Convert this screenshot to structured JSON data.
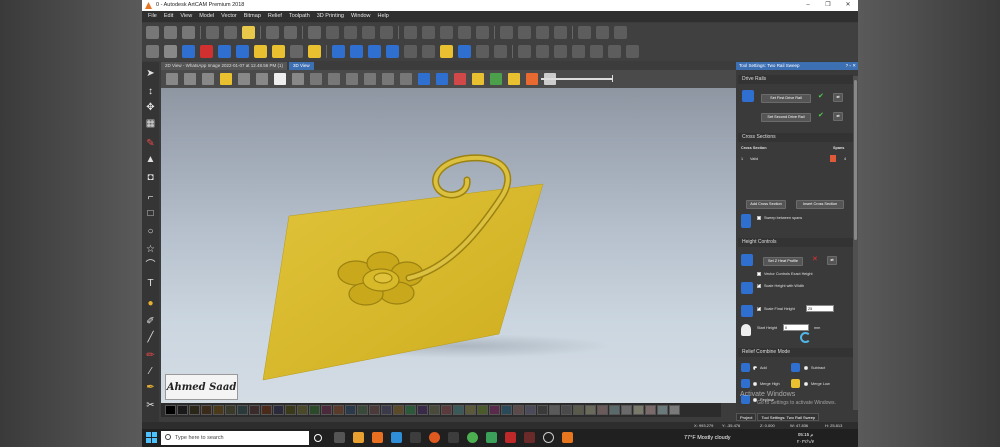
{
  "titlebar": {
    "title": "0 - Autodesk ArtCAM Premium 2018",
    "controls": [
      "–",
      "❐",
      "✕"
    ]
  },
  "menu": [
    "File",
    "Edit",
    "View",
    "Model",
    "Vector",
    "Bitmap",
    "Relief",
    "Toolpath",
    "3D Printing",
    "Window",
    "Help"
  ],
  "tabs": [
    {
      "label": "2D View - WhatsApp Image 2022-01-07 at 12.48.56 PM (1)"
    },
    {
      "label": "3D View"
    }
  ],
  "signature": "Ahmed Saad",
  "panel": {
    "title": "Tool Settings: Two Rail Sweep",
    "title_controls": "? ▫ ✕",
    "drive_rails": {
      "heading": "Drive Rails",
      "first_button": "Set First Drive Rail",
      "second_button": "Set Second Drive Rail"
    },
    "cross_sections": {
      "heading": "Cross Sections",
      "col_cross_section": "Cross Section",
      "col_spans": "Spans",
      "row_index": "1",
      "row_status": "Valid",
      "row_spans": "4",
      "add_button": "Add Cross Section",
      "insert_button": "Insert Cross Section",
      "sweep_between_spans": "Sweep between spans"
    },
    "height_controls": {
      "heading": "Height Controls",
      "set_profile_button": "Set Z Heat Profile",
      "vector_controls": "Vector Controls Exact Height",
      "scale_height": "Scale Height with Width",
      "scale_final_height": "Scale Final Height",
      "final_height_value": "25",
      "start_height_label": "Start Height",
      "start_height_value": "0",
      "unit": "mm"
    },
    "relief_combine": {
      "heading": "Relief Combine Mode",
      "add": "Add",
      "subtract": "Subtract",
      "merge_high": "Merge High",
      "merge_low": "Merge Low",
      "replace": "Replace"
    }
  },
  "panel_tabs": [
    "Project",
    "Tool Settings: Two Rail Sweep"
  ],
  "watermark": {
    "line1": "Activate Windows",
    "line2": "Go to Settings to activate Windows."
  },
  "status": {
    "x": "X: 993.279",
    "y": "Y: -35.476",
    "z": "Z: 0.000",
    "w": "W: 47.836",
    "h": "H: 25.813"
  },
  "taskbar": {
    "search": "Type here to search",
    "weather": "77°F  Mostly cloudy",
    "time": "05:15 م",
    "date": "٢٠٢٢/١/٧"
  },
  "colors": {
    "accent": "#3d6fb3",
    "relief": "#d4b82a",
    "panel_bg": "#3a3a3a",
    "viewport_top": "#8e96a2",
    "viewport_bottom": "#d4dce4"
  }
}
